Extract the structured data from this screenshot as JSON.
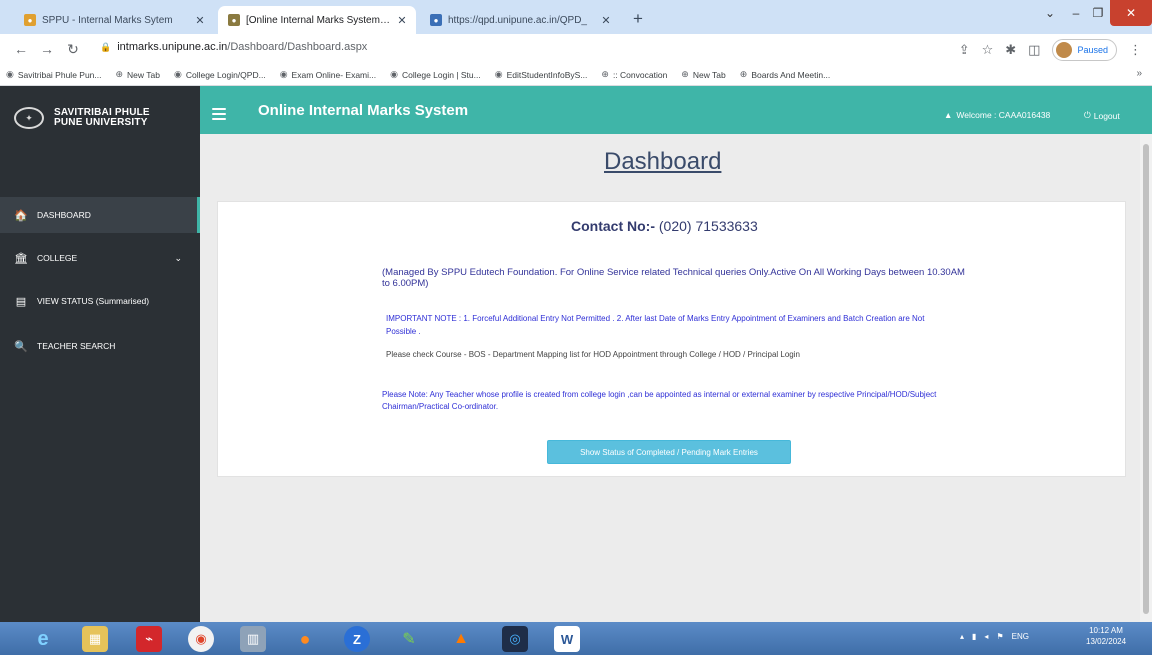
{
  "browser": {
    "tabs": [
      {
        "title": "SPPU - Internal Marks Sytem",
        "active": false
      },
      {
        "title": "[Online Internal Marks System [S",
        "active": true
      },
      {
        "title": "https://qpd.unipune.ac.in/QPD_",
        "active": false
      }
    ],
    "url_host": "intmarks.unipune.ac.in",
    "url_path": "/Dashboard/Dashboard.aspx",
    "profile_status": "Paused",
    "bookmarks": [
      "Savitribai Phule Pun...",
      "New Tab",
      "College Login/QPD...",
      "Exam Online- Exami...",
      "College Login | Stu...",
      "EditStudentInfoByS...",
      ":: Convocation",
      "New Tab",
      "Boards And Meetin..."
    ]
  },
  "header": {
    "brand_line1": "SAVITRIBAI PHULE",
    "brand_line2": "PUNE UNIVERSITY",
    "system_title": "Online Internal Marks System",
    "welcome_label": "Welcome : CAAA016438",
    "logout_label": "Logout"
  },
  "sidebar": {
    "items": [
      {
        "label": "DASHBOARD",
        "icon": "dashboard-icon"
      },
      {
        "label": "COLLEGE",
        "icon": "college-icon"
      },
      {
        "label": "VIEW STATUS (Summarised)",
        "icon": "status-icon"
      },
      {
        "label": "TEACHER SEARCH",
        "icon": "search-icon"
      }
    ]
  },
  "main": {
    "title": "Dashboard",
    "contact_label": "Contact No:-",
    "contact_number": "(020) 71533633",
    "managed_text": "(Managed By SPPU Edutech Foundation. For Online Service related Technical queries Only.Active On All Working Days between 10.30AM to 6.00PM)",
    "important_note": "IMPORTANT NOTE : 1. Forceful Additional Entry Not Permitted . 2. After last Date of Marks Entry Appointment of Examiners and Batch Creation are Not Possible .",
    "check_note": "Please check Course - BOS - Department Mapping list for HOD Appointment through College / HOD / Principal Login",
    "please_note": "Please Note: Any Teacher whose profile is created from college login ,can be appointed as internal or external examiner by respective Principal/HOD/Subject Chairman/Practical Co-ordinator.",
    "status_button": "Show Status of Completed / Pending Mark Entries"
  },
  "taskbar": {
    "tray_lang": "ENG",
    "time": "10:12 AM",
    "date": "13/02/2024"
  },
  "colors": {
    "header_teal": "#3fb5a8",
    "sidebar_dark": "#2b3035",
    "button_info": "#5bc0de",
    "title_navy": "#3a4b6a"
  }
}
